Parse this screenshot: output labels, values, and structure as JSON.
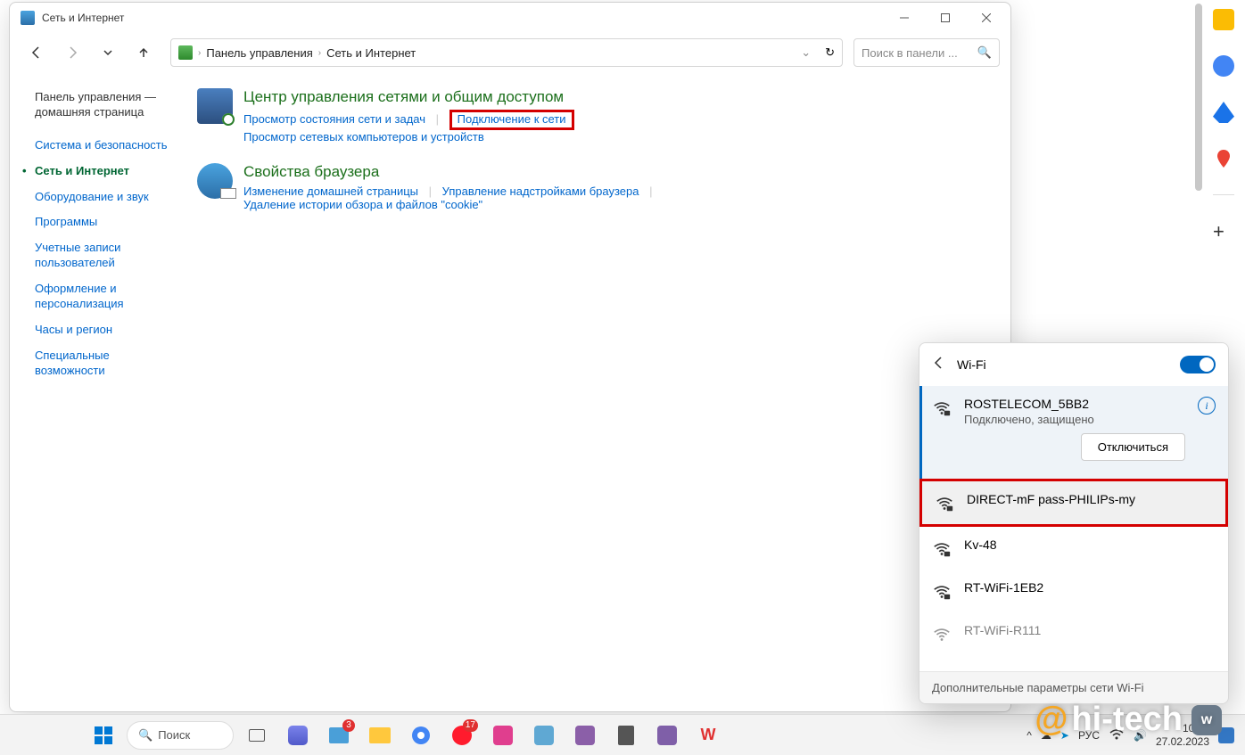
{
  "window": {
    "title": "Сеть и Интернет",
    "breadcrumb": {
      "root": "Панель управления",
      "current": "Сеть и Интернет"
    },
    "search_placeholder": "Поиск в панели ..."
  },
  "sidebar": {
    "home": "Панель управления — домашняя страница",
    "items": [
      "Система и безопасность",
      "Сеть и Интернет",
      "Оборудование и звук",
      "Программы",
      "Учетные записи пользователей",
      "Оформление и персонализация",
      "Часы и регион",
      "Специальные возможности"
    ],
    "active_index": 1
  },
  "sections": {
    "net": {
      "title": "Центр управления сетями и общим доступом",
      "links": [
        "Просмотр состояния сети и задач",
        "Подключение к сети",
        "Просмотр сетевых компьютеров и устройств"
      ],
      "highlight_index": 1
    },
    "browser": {
      "title": "Свойства браузера",
      "links": [
        "Изменение домашней страницы",
        "Управление надстройками браузера",
        "Удаление истории обзора и файлов \"cookie\""
      ]
    }
  },
  "wifi": {
    "header": "Wi-Fi",
    "connected": {
      "ssid": "ROSTELECOM_5BB2",
      "status": "Подключено, защищено",
      "disconnect": "Отключиться"
    },
    "networks": [
      "DIRECT-mF pass-PHILIPs-my",
      "Kv-48",
      "RT-WiFi-1EB2",
      "RT-WiFi-R111"
    ],
    "highlight_index": 0,
    "footer": "Дополнительные параметры сети Wi-Fi"
  },
  "taskbar": {
    "search": "Поиск",
    "lang": "РУС",
    "time": "10:26",
    "date": "27.02.2023",
    "chat_badge": "3"
  },
  "watermark": {
    "at": "@",
    "text": "hi-tech",
    "vk": "w"
  }
}
